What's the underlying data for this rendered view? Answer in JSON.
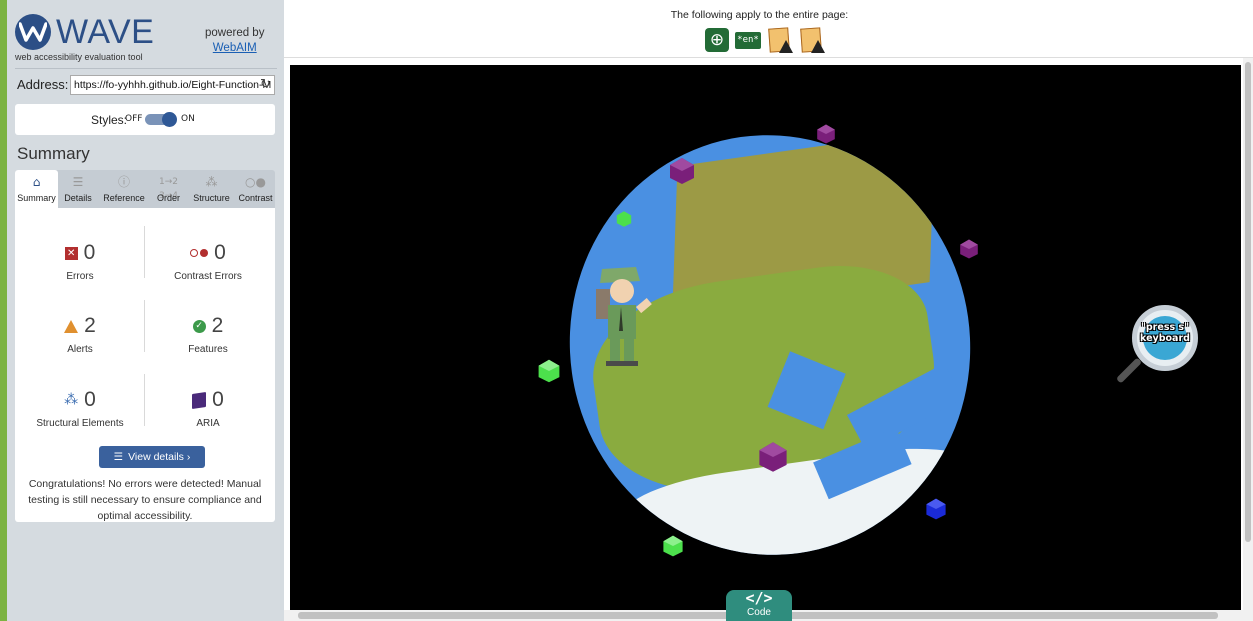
{
  "sidebar": {
    "brand": "WAVE",
    "brand_subtitle": "web accessibility evaluation tool",
    "powered_by": "powered by",
    "powered_link": "WebAIM",
    "address_label": "Address:",
    "address_value": "https://fo-yyhhh.github.io/Eight-Function-M",
    "styles_label": "Styles:",
    "styles_off": "OFF",
    "styles_on": "ON",
    "styles_state": "on",
    "summary_title": "Summary",
    "tabs": [
      {
        "label": "Summary",
        "icon": "home-icon",
        "active": true
      },
      {
        "label": "Details",
        "icon": "list-icon",
        "active": false
      },
      {
        "label": "Reference",
        "icon": "info-icon",
        "active": false
      },
      {
        "label": "Order",
        "icon": "order-icon",
        "active": false
      },
      {
        "label": "Structure",
        "icon": "structure-icon",
        "active": false
      },
      {
        "label": "Contrast",
        "icon": "contrast-icon",
        "active": false
      }
    ],
    "stats": {
      "errors": {
        "count": "0",
        "label": "Errors"
      },
      "contrast_errors": {
        "count": "0",
        "label": "Contrast Errors"
      },
      "alerts": {
        "count": "2",
        "label": "Alerts"
      },
      "features": {
        "count": "2",
        "label": "Features"
      },
      "structural": {
        "count": "0",
        "label": "Structural Elements"
      },
      "aria": {
        "count": "0",
        "label": "ARIA"
      }
    },
    "view_details": "View details ›",
    "congrats": "Congratulations! No errors were detected! Manual testing is still necessary to ensure compliance and optimal accessibility."
  },
  "topbar": {
    "text": "The following apply to the entire page:",
    "lang_badge": "*en*"
  },
  "canvas": {
    "press_hint": "\"press s\" keyboard"
  },
  "code_button": {
    "glyph": "</>",
    "label": "Code"
  },
  "colors": {
    "accent": "#2c4f86",
    "rail": "#7cb342",
    "error": "#b22f2f",
    "alert": "#e0902f",
    "feature": "#3c9a4a",
    "code": "#2f8d7e"
  }
}
